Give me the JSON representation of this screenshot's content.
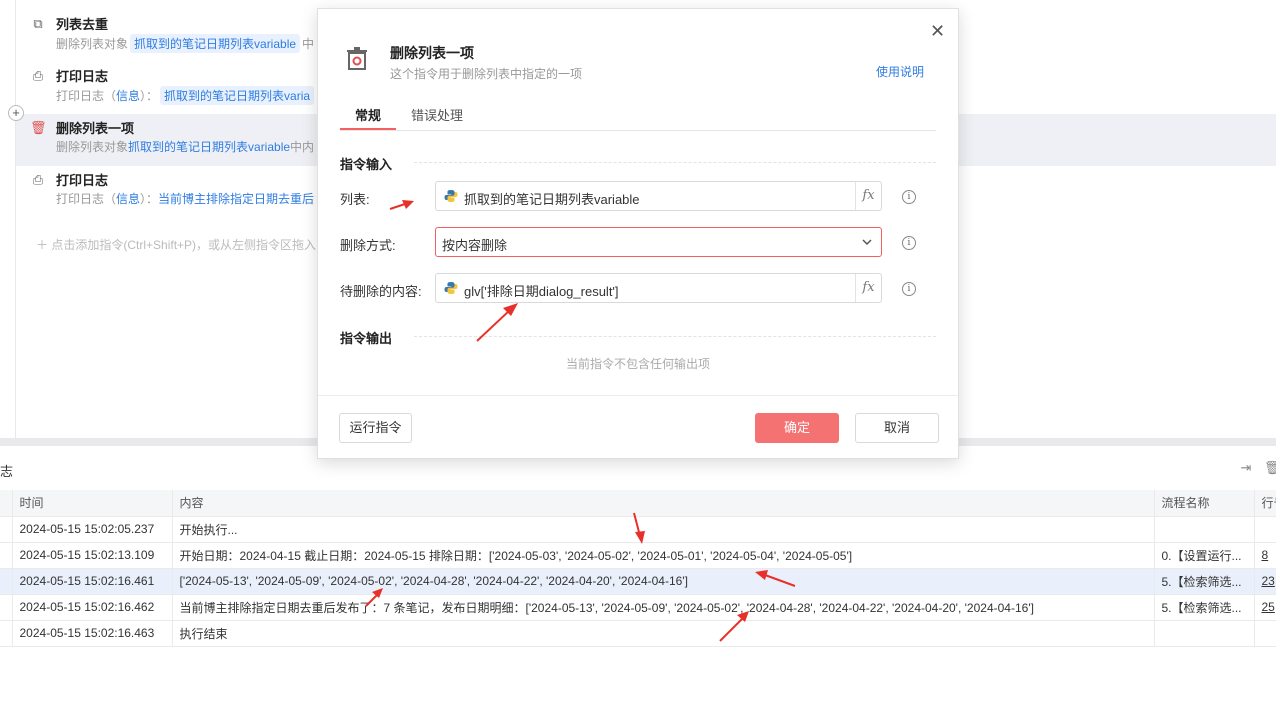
{
  "editor": {
    "steps": [
      {
        "title": "列表去重",
        "desc_prefix": "删除列表对象",
        "desc_tag": "抓取到的笔记日期列表variable",
        "desc_suffix": "中"
      },
      {
        "title": "打印日志",
        "desc_prefix": "打印日志（",
        "desc_link": "信息",
        "desc_mid": "）：",
        "desc_tag": "抓取到的笔记日期列表varia"
      },
      {
        "title": "删除列表一项",
        "desc_prefix": "删除列表对象",
        "desc_tag": "抓取到的笔记日期列表variable",
        "desc_suffix": "中内"
      },
      {
        "title": "打印日志",
        "desc_prefix": "打印日志（",
        "desc_link": "信息",
        "desc_mid": "）：",
        "desc_tail": "当前博主排除指定日期去重后"
      }
    ],
    "add_hint": "点击添加指令(Ctrl+Shift+P)，或从左侧指令区拖入"
  },
  "log": {
    "title": "志",
    "columns": [
      "时间",
      "内容",
      "流程名称",
      "行号"
    ],
    "rows": [
      {
        "time": "2024-05-15 15:02:05.237",
        "content": "开始执行...",
        "flow": "",
        "line": ""
      },
      {
        "time": "2024-05-15 15:02:13.109",
        "content": "开始日期：2024-04-15    截止日期：2024-05-15   排除日期：['2024-05-03', '2024-05-02', '2024-05-01', '2024-05-04', '2024-05-05']",
        "flow": "0.【设置运行...",
        "line": "8"
      },
      {
        "time": "2024-05-15 15:02:16.461",
        "content": "['2024-05-13', '2024-05-09', '2024-05-02', '2024-04-28', '2024-04-22', '2024-04-20', '2024-04-16']",
        "flow": "5.【检索筛选...",
        "line": "23"
      },
      {
        "time": "2024-05-15 15:02:16.462",
        "content": "当前博主排除指定日期去重后发布了：7  条笔记，发布日期明细：['2024-05-13', '2024-05-09', '2024-05-02', '2024-04-28', '2024-04-22', '2024-04-20', '2024-04-16']",
        "flow": "5.【检索筛选...",
        "line": "25"
      },
      {
        "time": "2024-05-15 15:02:16.463",
        "content": "执行结束",
        "flow": "",
        "line": ""
      }
    ]
  },
  "modal": {
    "title": "删除列表一项",
    "subtitle": "这个指令用于删除列表中指定的一项",
    "help": "使用说明",
    "tabs": [
      "常规",
      "错误处理"
    ],
    "input_section": "指令输入",
    "output_section": "指令输出",
    "fields": {
      "list_label": "列表:",
      "list_value": "抓取到的笔记日期列表variable",
      "method_label": "删除方式:",
      "method_value": "按内容删除",
      "content_label": "待删除的内容:",
      "content_value": "glv['排除日期dialog_result']"
    },
    "fx": "fx",
    "no_output": "当前指令不包含任何输出项",
    "run_button": "运行指令",
    "ok_button": "确定",
    "cancel_button": "取消"
  },
  "colors": {
    "accent": "#f2605f",
    "link": "#2f7de1",
    "arrow": "#e8302a"
  }
}
